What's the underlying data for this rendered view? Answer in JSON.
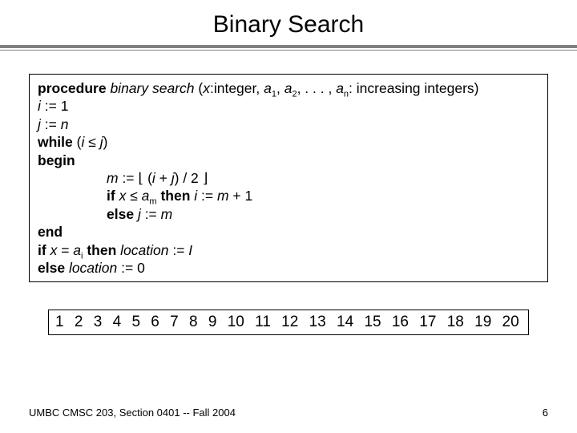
{
  "title": "Binary Search",
  "algo": {
    "l1": {
      "kw": "procedure",
      "name": "binary search",
      "sig_open": " (",
      "x": "x",
      "colon_int": ":integer, ",
      "a": "a",
      "sub1": "1",
      "comma1": ", ",
      "sub2": "2",
      "ellipsis": ", . . . , ",
      "subn": "n",
      "sig_close": ": increasing integers)"
    },
    "l2": {
      "var": "i",
      "rest": " := 1"
    },
    "l3": {
      "var": "j",
      "rest": " := ",
      "n": "n"
    },
    "l4": {
      "kw": "while",
      "open": " (",
      "i": "i",
      "le": " ≤ ",
      "j": "j",
      "close": ")"
    },
    "l5": {
      "kw": "begin"
    },
    "l6": {
      "m": "m",
      "assign": " := ⌊ (",
      "i": "i",
      "plus": " + ",
      "j": "j",
      "rest": ") / 2 ⌋"
    },
    "l7": {
      "kw": "if",
      "sp": " ",
      "x": "x",
      "le": " ≤ ",
      "a": "a",
      "subm": "m",
      "kw2": " then",
      "sp2": " ",
      "i": "i",
      "assign": " := ",
      "m": "m",
      "rest": " + 1"
    },
    "l8": {
      "kw": "else",
      "sp": " ",
      "j": "j",
      "assign": " := ",
      "m": "m"
    },
    "l9": {
      "kw": "end"
    },
    "l10": {
      "kw": "if",
      "sp": " ",
      "x": "x",
      "eq": " = ",
      "a": "a",
      "subi": "i",
      "kw2": " then",
      "sp2": " ",
      "loc": "location",
      "assign": " := ",
      "I": "I"
    },
    "l11": {
      "kw": "else",
      "sp": " ",
      "loc": "location",
      "rest": " := 0"
    }
  },
  "numbers": [
    "1",
    "2",
    "3",
    "4",
    "5",
    "6",
    "7",
    "8",
    "9",
    "10",
    "11",
    "12",
    "13",
    "14",
    "15",
    "16",
    "17",
    "18",
    "19",
    "20"
  ],
  "footer": {
    "left": "UMBC CMSC 203, Section 0401 -- Fall 2004",
    "page": "6"
  }
}
